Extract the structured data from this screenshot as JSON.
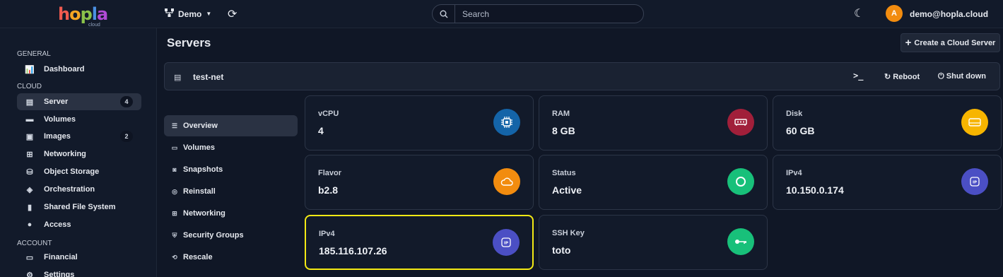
{
  "topbar": {
    "logo_text": "hopla",
    "logo_sub": "cloud",
    "project": "Demo",
    "search_placeholder": "Search",
    "avatar_initial": "A",
    "user_email": "demo@hopla.cloud"
  },
  "nav": {
    "section_general": "GENERAL",
    "section_cloud": "CLOUD",
    "section_account": "ACCOUNT",
    "dashboard": "Dashboard",
    "server": "Server",
    "server_count": "4",
    "volumes": "Volumes",
    "images": "Images",
    "images_count": "2",
    "networking": "Networking",
    "object_storage": "Object Storage",
    "orchestration": "Orchestration",
    "shared_fs": "Shared File System",
    "access": "Access",
    "financial": "Financial",
    "settings": "Settings"
  },
  "page": {
    "title": "Servers",
    "create_button": "Create a Cloud Server",
    "server_name": "test-net",
    "reboot": "Reboot",
    "shutdown": "Shut down"
  },
  "subnav": {
    "overview": "Overview",
    "volumes": "Volumes",
    "snapshots": "Snapshots",
    "reinstall": "Reinstall",
    "networking": "Networking",
    "security_groups": "Security Groups",
    "rescale": "Rescale"
  },
  "cards": {
    "vcpu": {
      "label": "vCPU",
      "value": "4"
    },
    "ram": {
      "label": "RAM",
      "value": "8 GB"
    },
    "disk": {
      "label": "Disk",
      "value": "60 GB"
    },
    "flavor": {
      "label": "Flavor",
      "value": "b2.8"
    },
    "status": {
      "label": "Status",
      "value": "Active"
    },
    "ipv4_private": {
      "label": "IPv4",
      "value": "10.150.0.174"
    },
    "ipv4_public": {
      "label": "IPv4",
      "value": "185.116.107.26"
    },
    "ssh_key": {
      "label": "SSH Key",
      "value": "toto"
    }
  },
  "colors": {
    "cpu_icon": "#1464a8",
    "ram_icon": "#a11f3a",
    "disk_icon": "#f7b500",
    "flavor_icon": "#f28c0f",
    "status_icon": "#18c07a",
    "ip_icon": "#4b4fc4",
    "ssh_icon": "#18c07a",
    "highlight": "#f4ea14"
  }
}
